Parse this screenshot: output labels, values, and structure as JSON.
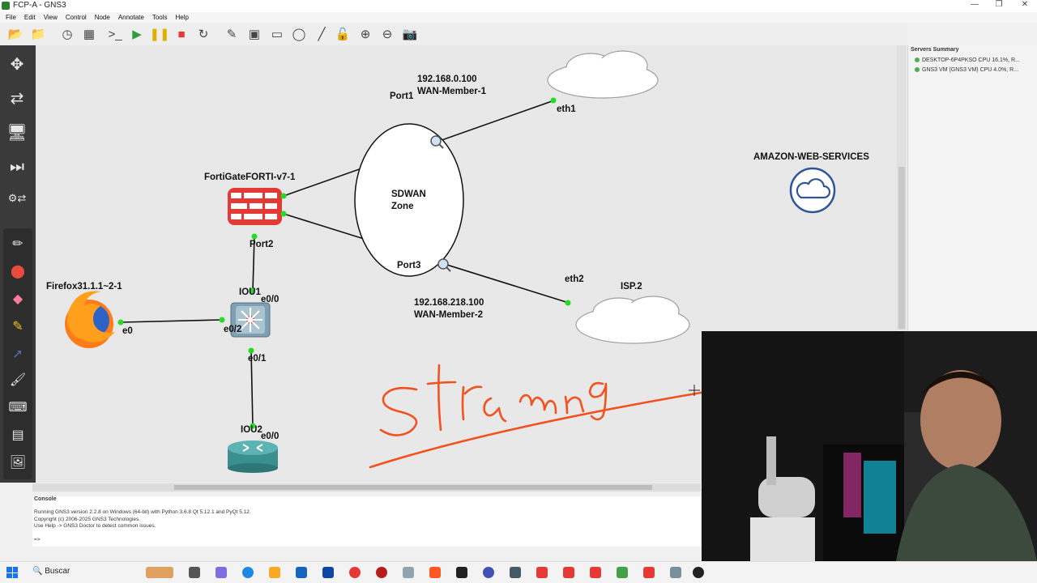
{
  "window": {
    "title": "FCP-A - GNS3",
    "controls": [
      "—",
      "❐",
      "✕"
    ]
  },
  "menu": [
    "File",
    "Edit",
    "View",
    "Control",
    "Node",
    "Annotate",
    "Tools",
    "Help"
  ],
  "topology": {
    "nodes": {
      "fortigate": {
        "name": "FortiGateFORTI-v7-1",
        "port_a": "Port1",
        "port_b": "Port2",
        "port_c": "Port3"
      },
      "firefox": {
        "name": "Firefox31.1.1~2-1",
        "port": "e0"
      },
      "iou1": {
        "name": "IOU1",
        "ports": [
          "e0/0",
          "e0/2",
          "e0/1"
        ]
      },
      "iou2": {
        "name": "IOU2",
        "port": "e0/0"
      },
      "wan1_cloud": {
        "port": "eth1"
      },
      "isp2": {
        "name": "ISP.2",
        "port": "eth2"
      },
      "aws": {
        "name": "AMAZON-WEB-SERVICES"
      }
    },
    "notes": {
      "wan1": [
        "192.168.0.100",
        "WAN-Member-1"
      ],
      "wan2": [
        "192.168.218.100",
        "WAN-Member-2"
      ],
      "zone": [
        "SDWAN",
        "Zone"
      ]
    },
    "drawing_text": "Streaming"
  },
  "servers_summary": {
    "title": "Servers Summary",
    "rows": [
      "DESKTOP-6P4PKSO CPU 16.1%, R...",
      "GNS3 VM (GNS3 VM) CPU 4.0%, R..."
    ]
  },
  "console": {
    "title": "Console",
    "lines": [
      "Running GNS3 version 2.2.8 on Windows (64-bit) with Python 3.6.8 Qt 5.12.1 and PyQt 5.12.",
      "Copyright (c) 2006-2025 GNS3 Technologies.",
      "Use Help -> GNS3 Doctor to detect common issues.",
      "",
      "=>"
    ]
  },
  "taskbar": {
    "search": "Buscar"
  },
  "colors": {
    "link_dot": "#22dd22",
    "forti_red": "#e53935",
    "annotation_red": "#f4511e",
    "cloud_outline": "#9aa0a6"
  }
}
